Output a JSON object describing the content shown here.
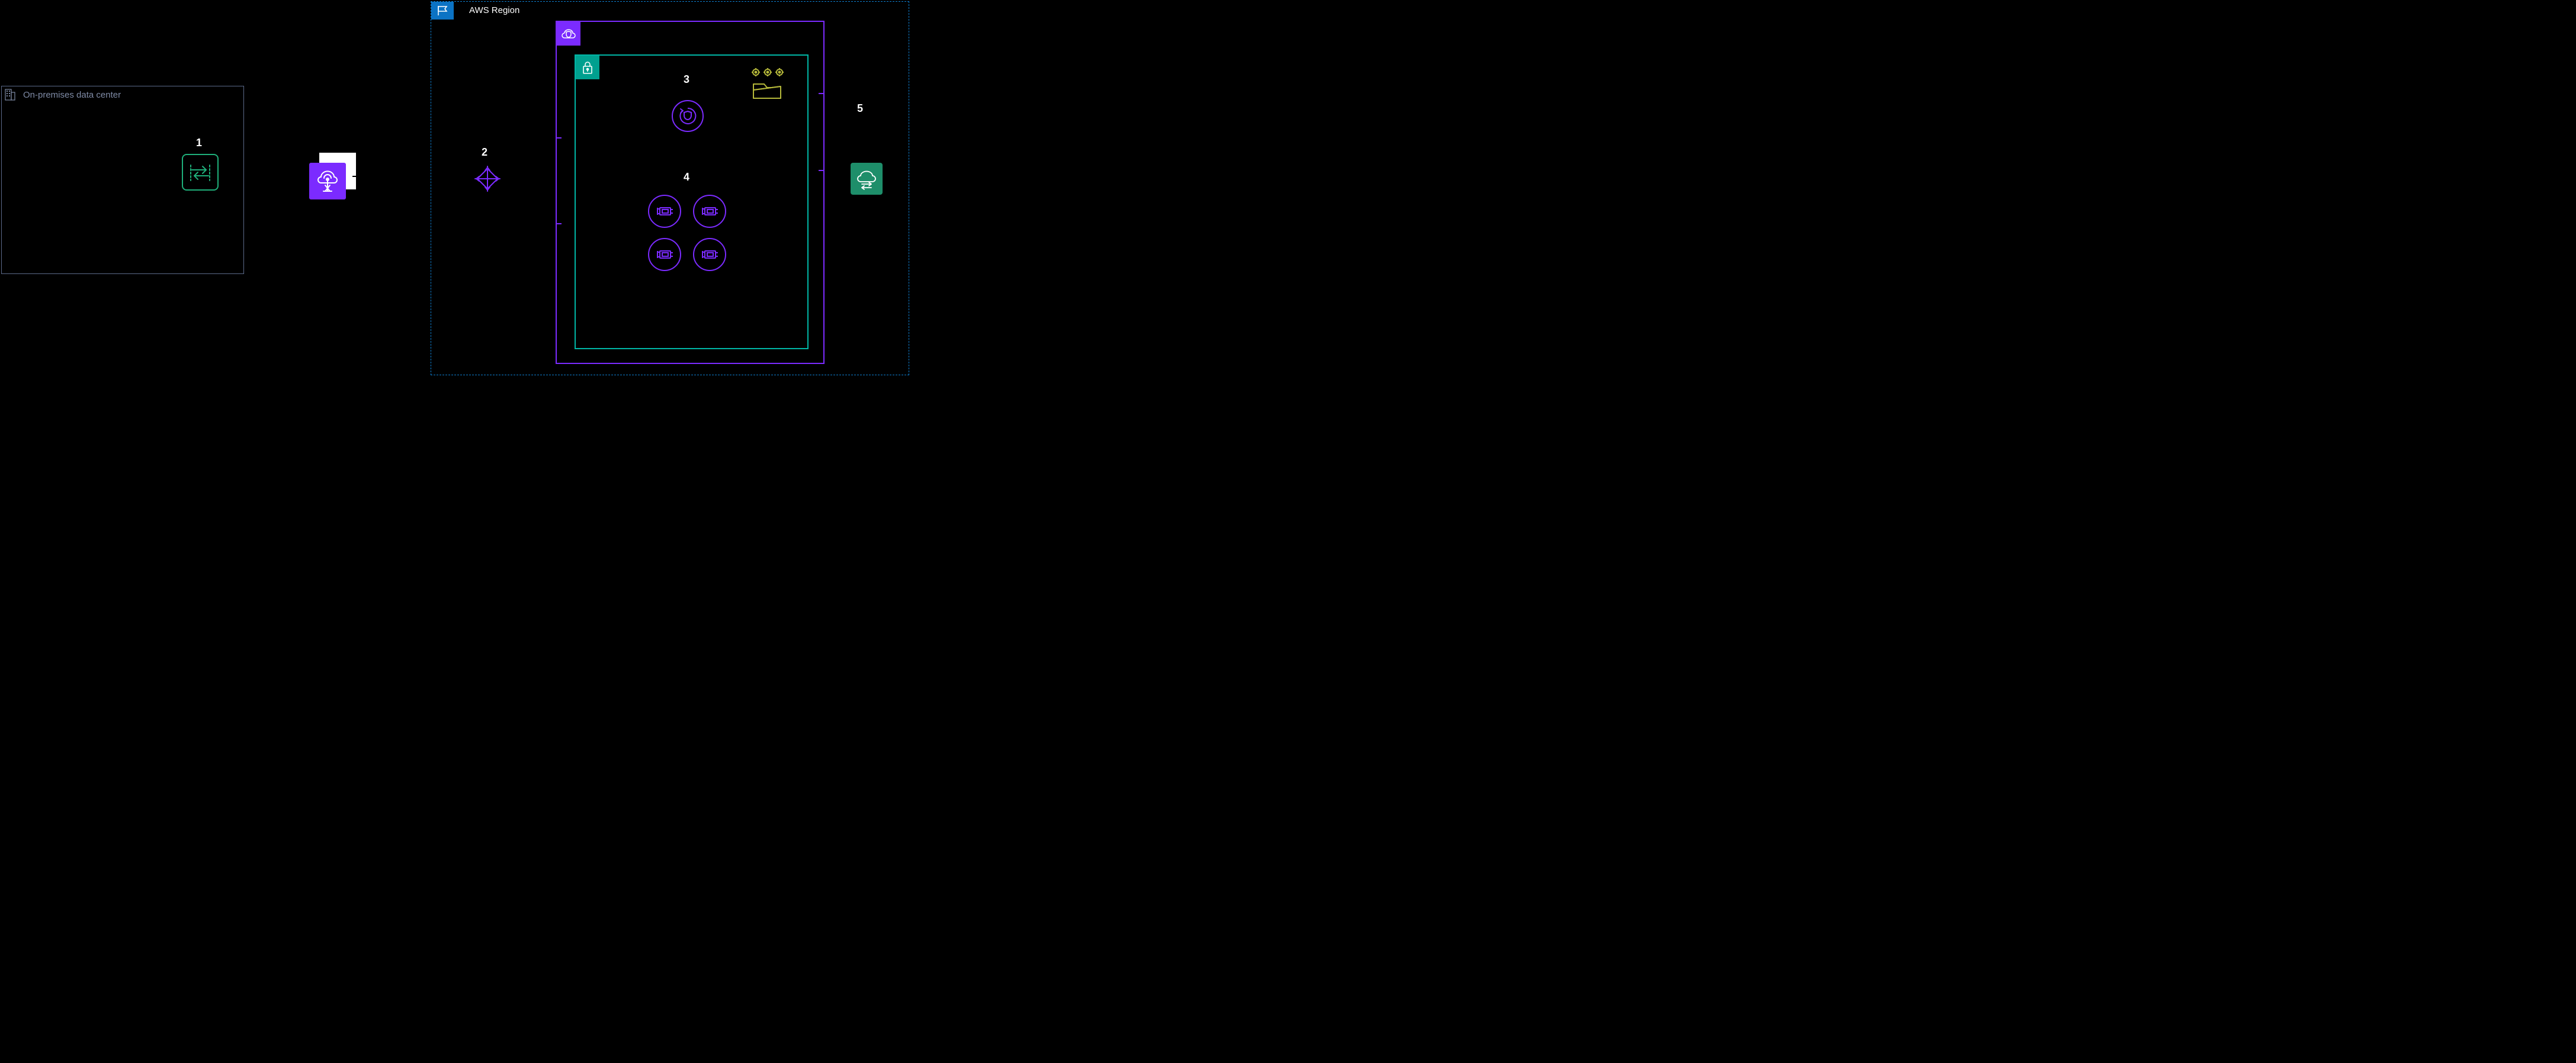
{
  "onprem": {
    "label": "On-premises data center"
  },
  "region": {
    "label": "AWS Region"
  },
  "numbers": {
    "n1": "1",
    "n2": "2",
    "n3": "3",
    "n4": "4",
    "n5": "5"
  },
  "icons": {
    "onprem_badge": "building-icon",
    "customer_gateway": "customer-gateway-icon",
    "direct_connect": "cloud-tower-icon",
    "region_flag": "flag-icon",
    "transit_gateway": "transit-gateway-icon",
    "vpc_cloud": "vpc-cloud-shield-icon",
    "subnet_lock": "lock-icon",
    "ec2_autoscale": "auto-scaling-group-icon",
    "compute_target": "compute-target-icon",
    "eni": "network-interface-icon",
    "nat_gateway": "nat-gateway-icon"
  },
  "colors": {
    "onprem_border": "#5b6a8a",
    "region_border": "#0e7ecf",
    "region_fill": "#0b73c4",
    "vpc": "#7b2bff",
    "subnet": "#00b5a5",
    "green": "#1faf7a",
    "olive": "#b5b83a",
    "nat": "#1e8e6a"
  }
}
